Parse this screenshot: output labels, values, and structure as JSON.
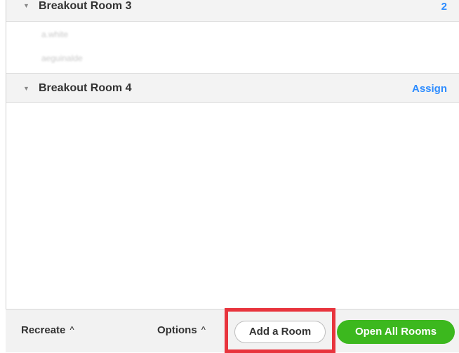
{
  "rooms": [
    {
      "name": "Breakout Room 3",
      "right_label": "2",
      "participants": [
        "a.white",
        "aeguinalde"
      ]
    },
    {
      "name": "Breakout Room 4",
      "right_label": "Assign",
      "participants": []
    }
  ],
  "footer": {
    "recreate_label": "Recreate",
    "options_label": "Options",
    "add_room_label": "Add a Room",
    "open_all_label": "Open All Rooms"
  },
  "icons": {
    "expand": "triangle-down-icon",
    "caret": "caret-up-icon"
  },
  "colors": {
    "link_blue": "#2d8cff",
    "primary_green": "#3cb81e",
    "highlight_red": "#e8343d"
  }
}
